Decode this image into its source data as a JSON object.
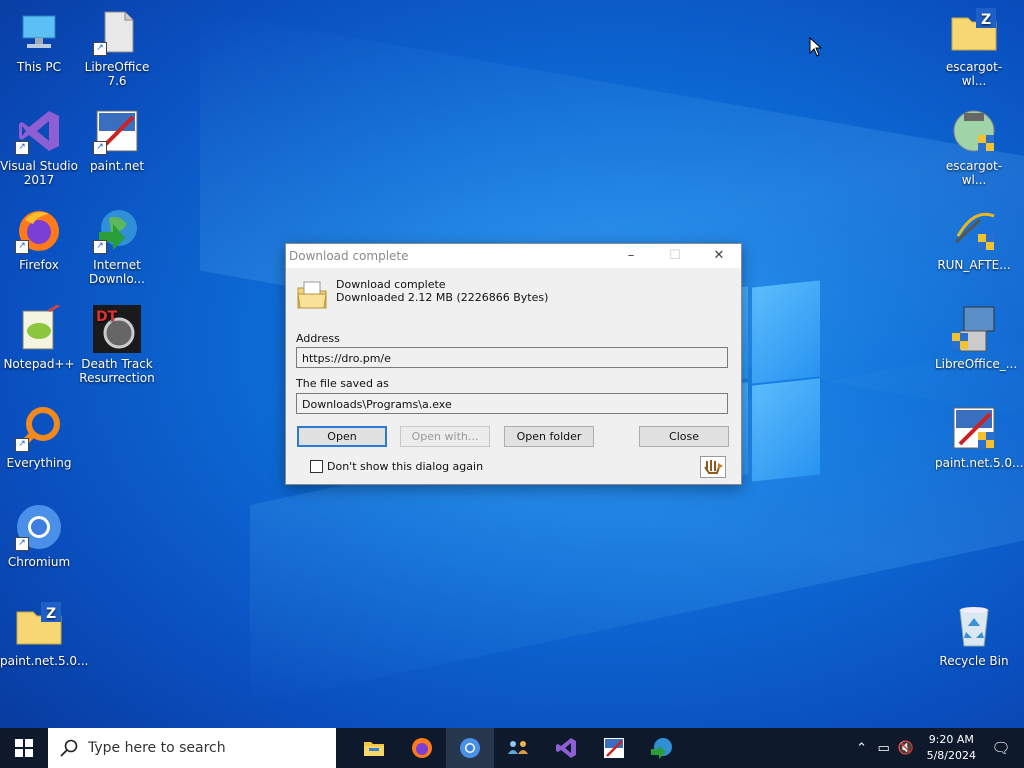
{
  "desktop": {
    "icons_left": [
      {
        "label": "This PC",
        "icon": "this-pc-icon"
      },
      {
        "label": "LibreOffice 7.6",
        "icon": "libreoffice-icon"
      },
      {
        "label": "Visual Studio 2017",
        "icon": "visual-studio-icon"
      },
      {
        "label": "paint.net",
        "icon": "paintnet-icon"
      },
      {
        "label": "Firefox",
        "icon": "firefox-icon"
      },
      {
        "label": "Internet Downlo...",
        "icon": "internet-download-manager-icon"
      },
      {
        "label": "Notepad++",
        "icon": "notepadpp-icon"
      },
      {
        "label": "Death Track Resurrection",
        "icon": "death-track-icon"
      },
      {
        "label": "Everything",
        "icon": "everything-search-icon"
      },
      {
        "label": "Chromium",
        "icon": "chromium-icon"
      },
      {
        "label": "paint.net.5.0...",
        "icon": "zip-folder-icon"
      }
    ],
    "icons_right": [
      {
        "label": "escargot-wl...",
        "icon": "zip-folder-icon"
      },
      {
        "label": "escargot-wl...",
        "icon": "installer-globe-icon"
      },
      {
        "label": "RUN_AFTE...",
        "icon": "script-wand-icon"
      },
      {
        "label": "LibreOffice_...",
        "icon": "installer-computer-icon"
      },
      {
        "label": "paint.net.5.0...",
        "icon": "paintnet-installer-icon"
      },
      {
        "label": "Recycle Bin",
        "icon": "recycle-bin-icon"
      }
    ]
  },
  "dialog": {
    "title": "Download complete",
    "heading": "Download complete",
    "size_text": "Downloaded 2.12  MB (2226866 Bytes)",
    "address_label": "Address",
    "address_value": "https://dro.pm/e",
    "saved_label": "The file saved as",
    "saved_value": "Downloads\\Programs\\a.exe",
    "buttons": {
      "open": "Open",
      "open_with": "Open with...",
      "open_folder": "Open folder",
      "close": "Close"
    },
    "checkbox_label": "Don't show this dialog again",
    "checkbox_checked": false
  },
  "taskbar": {
    "search_placeholder": "Type here to search",
    "apps": [
      "file-explorer-icon",
      "firefox-icon",
      "chromium-icon",
      "network-people-icon",
      "visual-studio-icon",
      "paintnet-icon",
      "internet-download-manager-icon"
    ],
    "time": "9:20 AM",
    "date": "5/8/2024"
  }
}
